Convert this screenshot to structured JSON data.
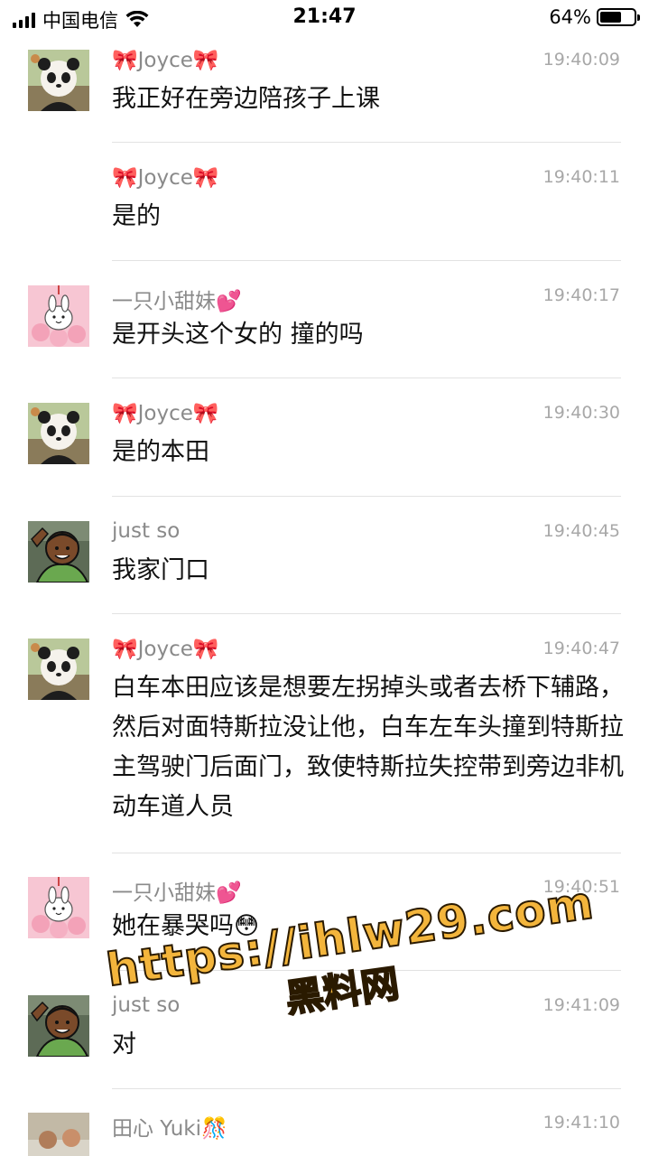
{
  "status_bar": {
    "carrier": "中国电信",
    "time": "21:47",
    "battery": "64%",
    "battery_level": 0.64
  },
  "messages": [
    {
      "sender": "🎀Joyce🎀",
      "time": "19:40:09",
      "text": "我正好在旁边陪孩子上课",
      "avatar": "panda-avatar",
      "show_avatar": true
    },
    {
      "sender": "🎀Joyce🎀",
      "time": "19:40:11",
      "text": "是的",
      "avatar": "panda-avatar",
      "show_avatar": false
    },
    {
      "sender": "一只小甜妹💕",
      "time": "19:40:17",
      "text": "是开头这个女的 撞的吗",
      "avatar": "bunny-avatar",
      "show_avatar": true
    },
    {
      "sender": "🎀Joyce🎀",
      "time": "19:40:30",
      "text": "是的本田",
      "avatar": "panda-avatar",
      "show_avatar": true
    },
    {
      "sender": "just so",
      "time": "19:40:45",
      "text": "我家门口",
      "avatar": "cartoon-man-avatar",
      "show_avatar": true
    },
    {
      "sender": "🎀Joyce🎀",
      "time": "19:40:47",
      "text": "白车本田应该是想要左拐掉头或者去桥下辅路，然后对面特斯拉没让他，白车左车头撞到特斯拉主驾驶门后面门，致使特斯拉失控带到旁边非机动车道人员",
      "avatar": "panda-avatar",
      "show_avatar": true
    },
    {
      "sender": "一只小甜妹💕",
      "time": "19:40:51",
      "text": "她在暴哭吗😳",
      "avatar": "bunny-avatar",
      "show_avatar": true
    },
    {
      "sender": "just so",
      "time": "19:41:09",
      "text": "对",
      "avatar": "cartoon-man-avatar",
      "show_avatar": true
    },
    {
      "sender": "田心 Yuki🎊",
      "time": "19:41:10",
      "text": "",
      "avatar": "photo-avatar",
      "show_avatar": true
    }
  ],
  "watermark": {
    "url": "https://ihlw29.com",
    "name": "黑料网"
  },
  "colors": {
    "timestamp": "#a8a8a8",
    "sender": "#8a8a8a",
    "divider": "#e2e2e2",
    "watermark": "#f3b53c"
  }
}
